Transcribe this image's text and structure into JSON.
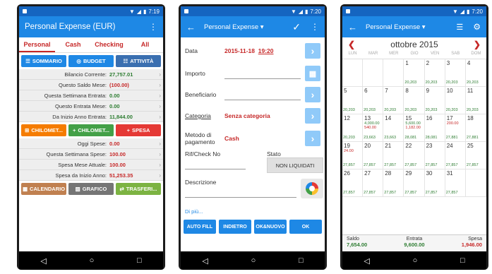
{
  "status": {
    "time1": "7:19",
    "time2": "7:20",
    "time3": "7:20"
  },
  "phone1": {
    "title": "Personal Expense (EUR)",
    "tabs": [
      "Personal",
      "Cash",
      "Checking",
      "All"
    ],
    "top_buttons": [
      "SOMMARIO",
      "BUDGET",
      "ATTIVITÀ"
    ],
    "rows_a": [
      {
        "label": "Bilancio Corrente:",
        "value": "27,757.01",
        "color": "green"
      },
      {
        "label": "Questo Saldo Mese:",
        "value": "(100.00)",
        "color": "red"
      },
      {
        "label": "Questa Settimana Entrata:",
        "value": "0.00",
        "color": "green"
      },
      {
        "label": "Questo Entrata Mese:",
        "value": "0.00",
        "color": "green"
      },
      {
        "label": "Da Inizio Anno Entrata:",
        "value": "11,844.00",
        "color": "green"
      }
    ],
    "mid_buttons": [
      "CHILOMET...",
      "CHILOMET...",
      "SPESA"
    ],
    "rows_b": [
      {
        "label": "Oggi Spese:",
        "value": "0.00",
        "color": "red"
      },
      {
        "label": "Questa Settimana Spese:",
        "value": "100.00",
        "color": "red"
      },
      {
        "label": "Spesa Mese Attuale:",
        "value": "100.00",
        "color": "red"
      },
      {
        "label": "Spesa da Inizio Anno:",
        "value": "51,253.35",
        "color": "red"
      }
    ],
    "bottom_buttons": [
      "CALENDARIO",
      "GRAFICO",
      "TRASFERI..."
    ]
  },
  "phone2": {
    "title": "Personal Expense",
    "data_label": "Data",
    "date": "2015-11-18",
    "time": "19:20",
    "amount_label": "Importo",
    "payee_label": "Beneficiario",
    "category_label": "Categoria",
    "category_value": "Senza categoria",
    "method_label": "Metodo di pagamento",
    "method_value": "Cash",
    "ref_label": "Rif/Check No",
    "state_label": "Stato",
    "state_value": "NON LIQUIDATI",
    "desc_label": "Descrizione",
    "more_link": "Di più...",
    "buttons": [
      "AUTO FILL",
      "INDIETRO",
      "OK&NUOVO",
      "OK"
    ]
  },
  "phone3": {
    "title": "Personal Expense",
    "month": "ottobre 2015",
    "weekdays": [
      "LUN",
      "MAR",
      "MER",
      "GIO",
      "VEN",
      "SAB",
      "DOM"
    ],
    "cells": [
      {
        "d": "",
        "lines": [],
        "amt": ""
      },
      {
        "d": "",
        "lines": [],
        "amt": ""
      },
      {
        "d": "",
        "lines": [],
        "amt": ""
      },
      {
        "d": "1",
        "lines": [],
        "amt": "20,203"
      },
      {
        "d": "2",
        "lines": [],
        "amt": "20,203"
      },
      {
        "d": "3",
        "lines": [],
        "amt": "20,203"
      },
      {
        "d": "4",
        "lines": [],
        "amt": "20,203"
      },
      {
        "d": "5",
        "lines": [],
        "amt": "20,203"
      },
      {
        "d": "6",
        "lines": [],
        "amt": "20,203"
      },
      {
        "d": "7",
        "lines": [],
        "amt": "20,203"
      },
      {
        "d": "8",
        "lines": [],
        "amt": "20,203"
      },
      {
        "d": "9",
        "lines": [],
        "amt": "20,203"
      },
      {
        "d": "10",
        "lines": [],
        "amt": "20,203"
      },
      {
        "d": "11",
        "lines": [],
        "amt": "20,203"
      },
      {
        "d": "12",
        "lines": [],
        "amt": "20,203"
      },
      {
        "d": "13",
        "lines": [
          "4,000.00",
          "540.00"
        ],
        "amt": "23,663"
      },
      {
        "d": "14",
        "lines": [],
        "amt": "23,663"
      },
      {
        "d": "15",
        "lines": [
          "5,600.00",
          "1,182.00"
        ],
        "amt": "28,081"
      },
      {
        "d": "16",
        "lines": [],
        "amt": "28,081"
      },
      {
        "d": "17",
        "lines": [
          "200.00"
        ],
        "amt": "27,881"
      },
      {
        "d": "18",
        "lines": [],
        "amt": "27,881"
      },
      {
        "d": "19",
        "lines": [
          "24.00"
        ],
        "amt": "27,857"
      },
      {
        "d": "20",
        "lines": [],
        "amt": "27,857"
      },
      {
        "d": "21",
        "lines": [],
        "amt": "27,857"
      },
      {
        "d": "22",
        "lines": [],
        "amt": "27,857"
      },
      {
        "d": "23",
        "lines": [],
        "amt": "27,857"
      },
      {
        "d": "24",
        "lines": [],
        "amt": "27,857"
      },
      {
        "d": "25",
        "lines": [],
        "amt": "27,857"
      },
      {
        "d": "26",
        "lines": [],
        "amt": "27,857"
      },
      {
        "d": "27",
        "lines": [],
        "amt": "27,857"
      },
      {
        "d": "28",
        "lines": [],
        "amt": "27,857"
      },
      {
        "d": "29",
        "lines": [],
        "amt": "27,857"
      },
      {
        "d": "30",
        "lines": [],
        "amt": "27,857"
      },
      {
        "d": "31",
        "lines": [],
        "amt": "27,857"
      },
      {
        "d": "",
        "lines": [],
        "amt": ""
      }
    ],
    "summary": {
      "balance_label": "Saldo",
      "balance": "7,654.00",
      "income_label": "Entrata",
      "income": "9,600.00",
      "expense_label": "Spesa",
      "expense": "1,946.00"
    }
  }
}
